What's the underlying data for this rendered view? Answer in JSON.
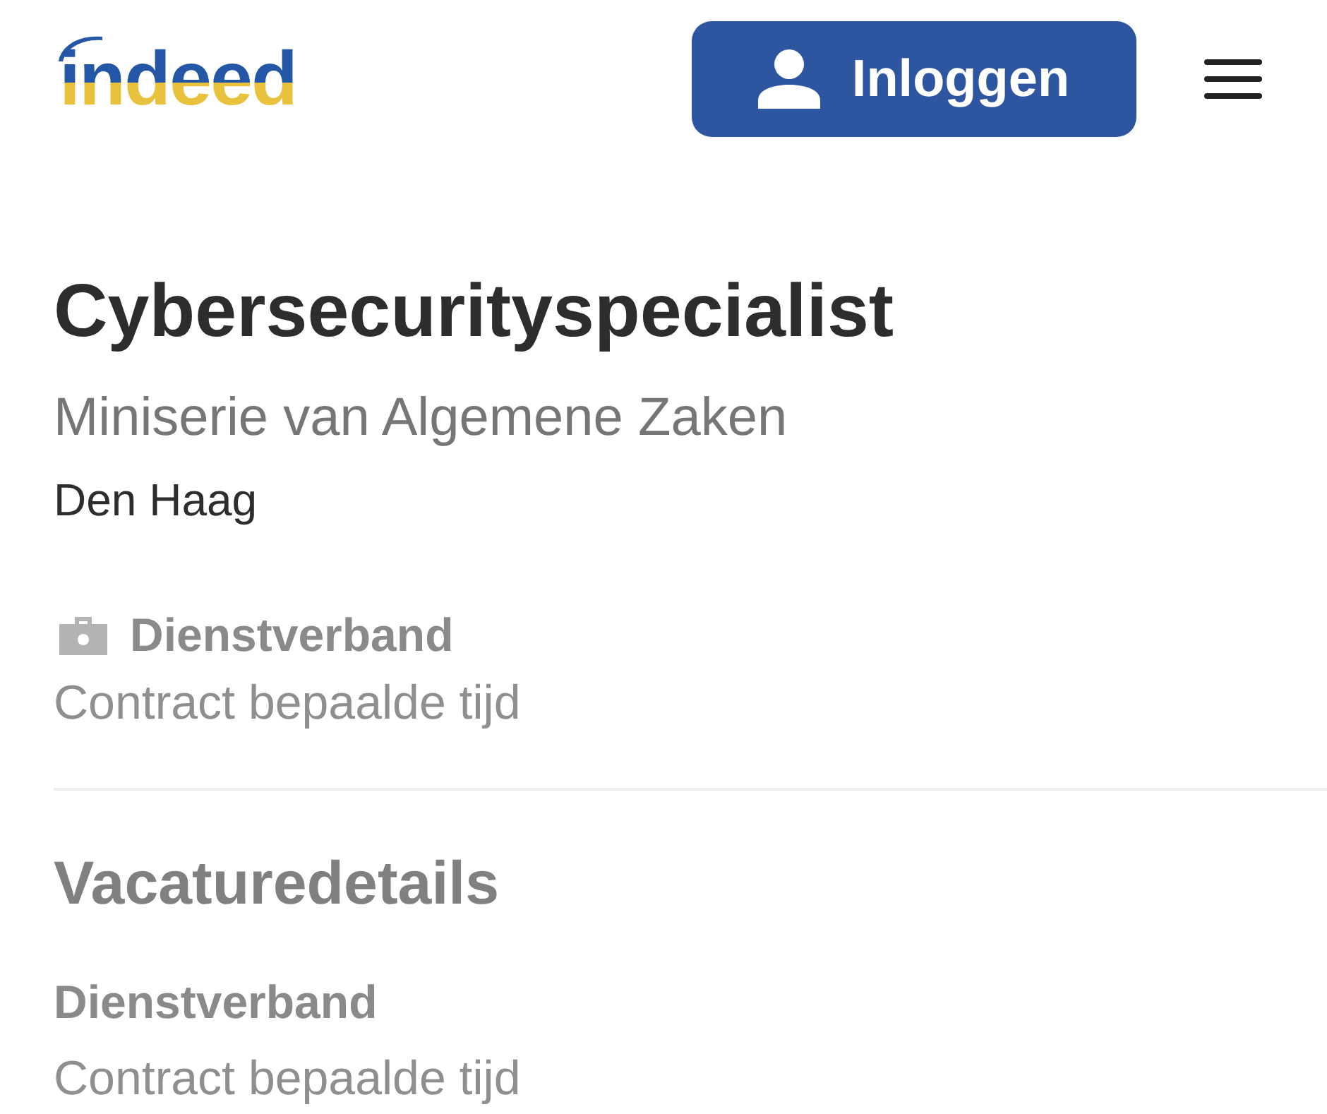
{
  "header": {
    "logo": "indeed",
    "login_button": "Inloggen"
  },
  "job": {
    "title": "Cybersecurityspecialist",
    "company": "Miniserie van Algemene Zaken",
    "location": "Den Haag"
  },
  "job_type": {
    "label": "Dienstverband",
    "value": "Contract bepaalde tijd"
  },
  "details": {
    "heading": "Vacaturedetails",
    "items": [
      {
        "label": "Dienstverband",
        "value": "Contract bepaalde tijd"
      }
    ]
  }
}
